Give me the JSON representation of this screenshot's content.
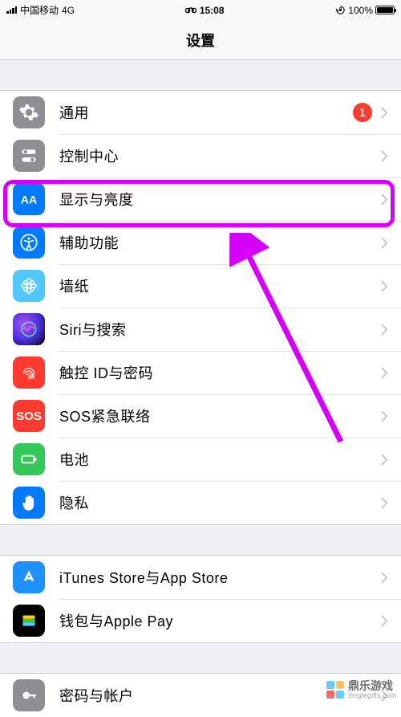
{
  "status": {
    "carrier": "中国移动",
    "network": "4G",
    "time": "15:08",
    "battery_pct": "100%"
  },
  "header": {
    "title": "设置"
  },
  "section1": [
    {
      "key": "general",
      "label": "通用",
      "icon_bg": "#8e8e93",
      "badge": "1"
    },
    {
      "key": "control-center",
      "label": "控制中心",
      "icon_bg": "#8e8e93"
    },
    {
      "key": "display",
      "label": "显示与亮度",
      "icon_bg": "#007aff"
    },
    {
      "key": "accessibility",
      "label": "辅助功能",
      "icon_bg": "#007aff"
    },
    {
      "key": "wallpaper",
      "label": "墙纸",
      "icon_bg": "#54c7fc"
    },
    {
      "key": "siri",
      "label": "Siri与搜索",
      "icon_bg": "#000000"
    },
    {
      "key": "touchid",
      "label": "触控 ID与密码",
      "icon_bg": "#ff3b30"
    },
    {
      "key": "sos",
      "label": "SOS紧急联络",
      "icon_bg": "#ff3b30",
      "icon_text": "SOS"
    },
    {
      "key": "battery",
      "label": "电池",
      "icon_bg": "#34c759"
    },
    {
      "key": "privacy",
      "label": "隐私",
      "icon_bg": "#007aff"
    }
  ],
  "section2": [
    {
      "key": "itunes",
      "label": "iTunes Store与App Store",
      "icon_bg": "#1e90ff"
    },
    {
      "key": "wallet",
      "label": "钱包与Apple Pay",
      "icon_bg": "#000000"
    }
  ],
  "section3": [
    {
      "key": "accounts",
      "label": "密码与帐户",
      "icon_bg": "#8e8e93"
    }
  ],
  "watermark": {
    "name": "鼎乐游戏",
    "url": "dinglegifts.com"
  }
}
